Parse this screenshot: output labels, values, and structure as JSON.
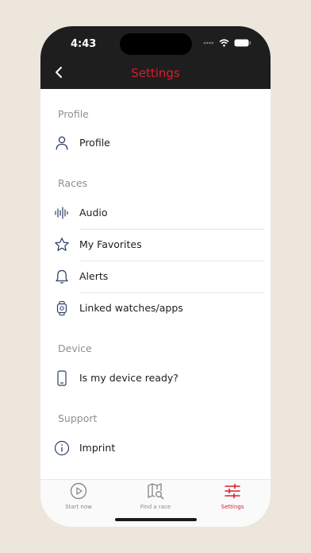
{
  "status": {
    "time": "4:43"
  },
  "header": {
    "title": "Settings"
  },
  "sections": {
    "profile": {
      "title": "Profile",
      "items": [
        {
          "label": "Profile",
          "icon": "person-icon"
        }
      ]
    },
    "races": {
      "title": "Races",
      "items": [
        {
          "label": "Audio",
          "icon": "audio-waveform-icon"
        },
        {
          "label": "My Favorites",
          "icon": "star-icon"
        },
        {
          "label": "Alerts",
          "icon": "bell-icon"
        },
        {
          "label": "Linked watches/apps",
          "icon": "watch-icon"
        }
      ]
    },
    "device": {
      "title": "Device",
      "items": [
        {
          "label": "Is my device ready?",
          "icon": "phone-icon"
        }
      ]
    },
    "support": {
      "title": "Support",
      "items": [
        {
          "label": "Imprint",
          "icon": "info-icon"
        }
      ]
    }
  },
  "tabbar": {
    "tabs": [
      {
        "label": "Start now",
        "icon": "play-circle-icon",
        "active": false
      },
      {
        "label": "Find a race",
        "icon": "map-search-icon",
        "active": false
      },
      {
        "label": "Settings",
        "icon": "sliders-icon",
        "active": true
      }
    ]
  },
  "colors": {
    "accent": "#d61f2c",
    "header_bg": "#1e1e1e",
    "icon": "#2c3e66",
    "background": "#ede6dd"
  }
}
